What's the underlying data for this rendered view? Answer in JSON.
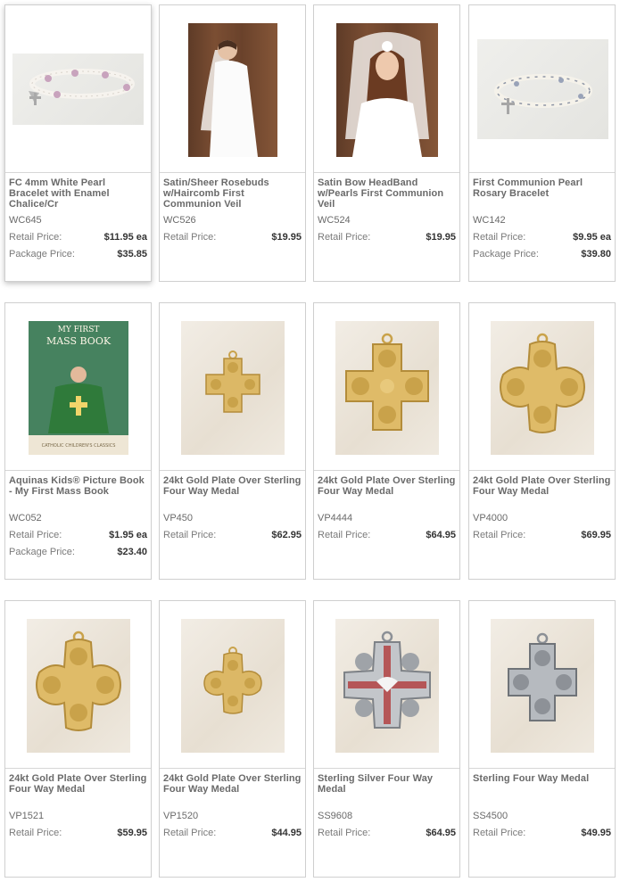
{
  "products": [
    {
      "title": "FC 4mm White Pearl Bracelet with Enamel Chalice/Cr",
      "sku": "WC645",
      "retail_label": "Retail Price:",
      "retail": "$11.95 ea",
      "package_label": "Package Price:",
      "package": "$35.85",
      "image": "pearl-bracelet-enamel"
    },
    {
      "title": "Satin/Sheer Rosebuds w/Haircomb First Communion Veil",
      "sku": "WC526",
      "retail_label": "Retail Price:",
      "retail": "$19.95",
      "image": "communion-veil-girl-side"
    },
    {
      "title": "Satin Bow HeadBand w/Pearls First Communion Veil",
      "sku": "WC524",
      "retail_label": "Retail Price:",
      "retail": "$19.95",
      "image": "communion-veil-girl-front"
    },
    {
      "title": "First Communion Pearl Rosary Bracelet",
      "sku": "WC142",
      "retail_label": "Retail Price:",
      "retail": "$9.95 ea",
      "package_label": "Package Price:",
      "package": "$39.80",
      "image": "pearl-rosary-bracelet"
    },
    {
      "title": "Aquinas Kids® Picture Book - My First Mass Book",
      "sku": "WC052",
      "retail_label": "Retail Price:",
      "retail": "$1.95 ea",
      "package_label": "Package Price:",
      "package": "$23.40",
      "image": "book-cover",
      "image_text": {
        "top": "MY FIRST",
        "main": "MASS BOOK",
        "bottom": "CATHOLIC CHILDREN'S CLASSICS"
      }
    },
    {
      "title": "24kt Gold Plate Over Sterling Four Way Medal",
      "sku": "VP450",
      "retail_label": "Retail Price:",
      "retail": "$62.95",
      "image": "gold-four-way-medal-small"
    },
    {
      "title": "24kt Gold Plate Over Sterling Four Way Medal",
      "sku": "VP4444",
      "retail_label": "Retail Price:",
      "retail": "$64.95",
      "image": "gold-four-way-medal-large"
    },
    {
      "title": "24kt Gold Plate Over Sterling Four Way Medal",
      "sku": "VP4000",
      "retail_label": "Retail Price:",
      "retail": "$69.95",
      "image": "gold-four-way-medal-large"
    },
    {
      "title": "24kt Gold Plate Over Sterling Four Way Medal",
      "sku": "VP1521",
      "retail_label": "Retail Price:",
      "retail": "$59.95",
      "image": "gold-four-way-medal-large"
    },
    {
      "title": "24kt Gold Plate Over Sterling Four Way Medal",
      "sku": "VP1520",
      "retail_label": "Retail Price:",
      "retail": "$44.95",
      "image": "gold-four-way-medal-small"
    },
    {
      "title": "Sterling Silver Four Way Medal",
      "sku": "SS9608",
      "retail_label": "Retail Price:",
      "retail": "$64.95",
      "image": "silver-four-way-medal-red-enamel"
    },
    {
      "title": "Sterling Four Way Medal",
      "sku": "SS4500",
      "retail_label": "Retail Price:",
      "retail": "$49.95",
      "image": "silver-four-way-medal"
    }
  ],
  "colors": {
    "gold": "#d7b35d",
    "silver": "#9a9ea3",
    "border": "#cfcfcf",
    "text": "#6a6a6a",
    "price": "#333333"
  }
}
